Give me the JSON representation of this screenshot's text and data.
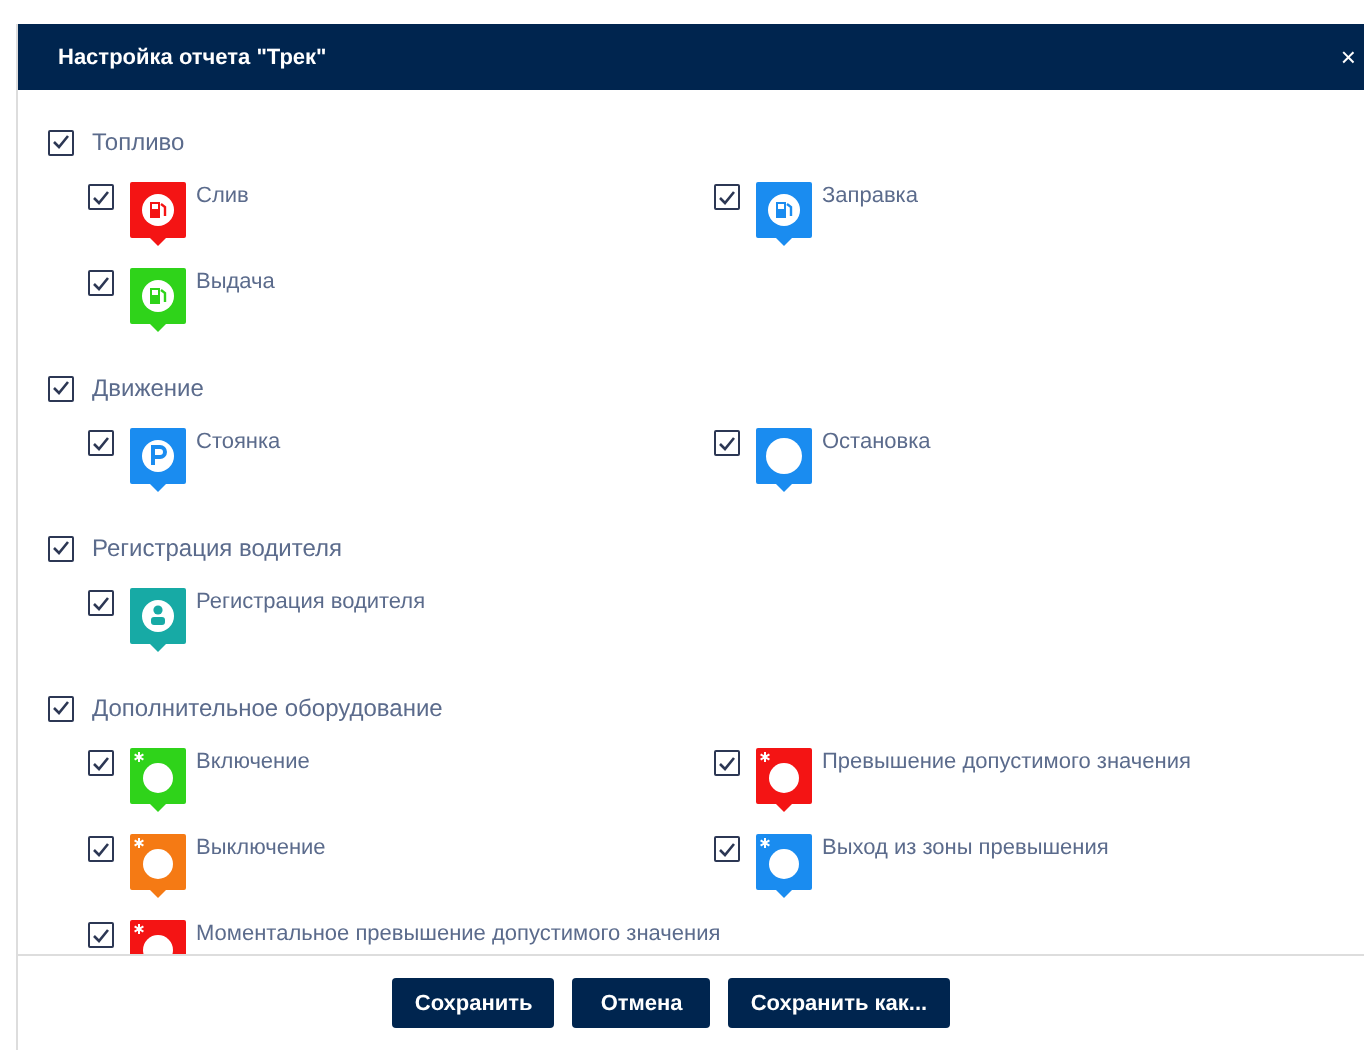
{
  "dialog": {
    "title": "Настройка отчета \"Трек\"",
    "close": "×"
  },
  "groups": [
    {
      "label": "Топливо",
      "checked": true,
      "items": [
        {
          "label": "Слив",
          "checked": true,
          "kind": "fuel",
          "color": "#f41414"
        },
        {
          "label": "Заправка",
          "checked": true,
          "kind": "fuel",
          "color": "#1a8cf0"
        },
        {
          "label": "Выдача",
          "checked": true,
          "kind": "fuel",
          "color": "#2fd31a"
        }
      ]
    },
    {
      "label": "Движение",
      "checked": true,
      "items": [
        {
          "label": "Стоянка",
          "checked": true,
          "kind": "parking",
          "color": "#1a8cf0"
        },
        {
          "label": "Остановка",
          "checked": true,
          "kind": "dot",
          "color": "#1a8cf0"
        }
      ]
    },
    {
      "label": "Регистрация водителя",
      "checked": true,
      "items": [
        {
          "label": "Регистрация водителя",
          "checked": true,
          "kind": "driver",
          "color": "#17aaa5"
        }
      ]
    },
    {
      "label": "Дополнительное оборудование",
      "checked": true,
      "items": [
        {
          "label": "Включение",
          "checked": true,
          "kind": "sensor",
          "color": "#2fd31a"
        },
        {
          "label": "Превышение допустимого значения",
          "checked": true,
          "kind": "sensor",
          "color": "#f41414"
        },
        {
          "label": "Выключение",
          "checked": true,
          "kind": "sensor",
          "color": "#f57a14"
        },
        {
          "label": "Выход из зоны превышения",
          "checked": true,
          "kind": "sensor",
          "color": "#1a8cf0"
        },
        {
          "label": "Моментальное превышение допустимого значения",
          "checked": true,
          "kind": "sensor",
          "color": "#f41414"
        }
      ]
    }
  ],
  "buttons": [
    "Сохранить",
    "Отмена",
    "Сохранить как..."
  ]
}
